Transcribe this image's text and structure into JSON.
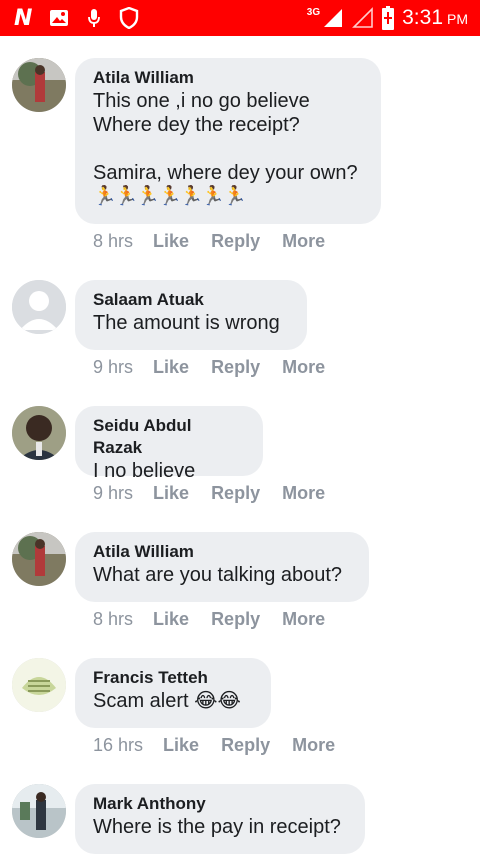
{
  "status_bar": {
    "network_label": "3G",
    "time": "3:31",
    "ampm": "PM",
    "background_color": "#ff0000",
    "left_icons": [
      "n-app-icon",
      "image-icon",
      "microphone-icon",
      "shield-icon"
    ],
    "right_icons": [
      "signal-icon",
      "no-signal-icon",
      "battery-charging-icon"
    ]
  },
  "comments": [
    {
      "author": "Atila William",
      "lines": "This one ,i no go believe\nWhere dey the receipt?\n\nSamira, where dey your own?",
      "emoji": "🏃🏃🏃🏃🏃🏃🏃",
      "time": "8 hrs",
      "like": "Like",
      "reply": "Reply",
      "more": "More"
    },
    {
      "author": "Salaam Atuak",
      "lines": "The amount is wrong",
      "time": "9 hrs",
      "like": "Like",
      "reply": "Reply",
      "more": "More"
    },
    {
      "author": "Seidu Abdul Razak",
      "lines": "I no believe",
      "time": "9 hrs",
      "like": "Like",
      "reply": "Reply",
      "more": "More"
    },
    {
      "author": "Atila William",
      "lines": "What are you talking about?",
      "time": "8 hrs",
      "like": "Like",
      "reply": "Reply",
      "more": "More"
    },
    {
      "author": "Francis Tetteh",
      "lines": "Scam alert 😂😂",
      "time": "16 hrs",
      "like": "Like",
      "reply": "Reply",
      "more": "More"
    },
    {
      "author": "Mark Anthony",
      "lines": "Where is the pay in receipt?"
    }
  ],
  "colors": {
    "bubble": "#eceef1",
    "meta_text": "#8d949e",
    "author_text": "#1c1e21"
  }
}
